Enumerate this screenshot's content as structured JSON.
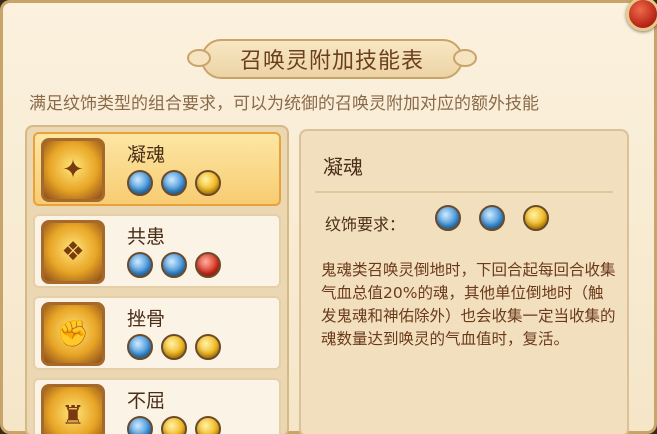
{
  "title": "召唤灵附加技能表",
  "subtitle": "满足纹饰类型的组合要求，可以为统御的召唤灵附加对应的额外技能",
  "skills": [
    {
      "name": "凝魂",
      "gems": [
        "blue",
        "blue",
        "gold"
      ],
      "selected": true,
      "icon": "soul-orb-icon"
    },
    {
      "name": "共患",
      "gems": [
        "blue",
        "blue",
        "red"
      ],
      "selected": false,
      "icon": "golden-hands-icon"
    },
    {
      "name": "挫骨",
      "gems": [
        "blue",
        "gold",
        "gold"
      ],
      "selected": false,
      "icon": "fist-strike-icon"
    },
    {
      "name": "不屈",
      "gems": [
        "blue",
        "gold",
        "gold"
      ],
      "selected": false,
      "icon": "warrior-icon"
    }
  ],
  "detail": {
    "name": "凝魂",
    "requirement_label": "纹饰要求：",
    "gems": [
      "blue",
      "blue",
      "gold"
    ],
    "description": "鬼魂类召唤灵倒地时，下回合起每回合收集气血总值20%的魂，其他单位倒地时（触发鬼魂和神佑除外）也会收集一定当收集的魂数量达到唤灵的气血值时，复活。"
  },
  "colors": {
    "blue_gem": "#3a8fd6",
    "gold_gem": "#f0b419",
    "red_gem": "#d7301f",
    "selected_bg": "#f7cc72"
  }
}
